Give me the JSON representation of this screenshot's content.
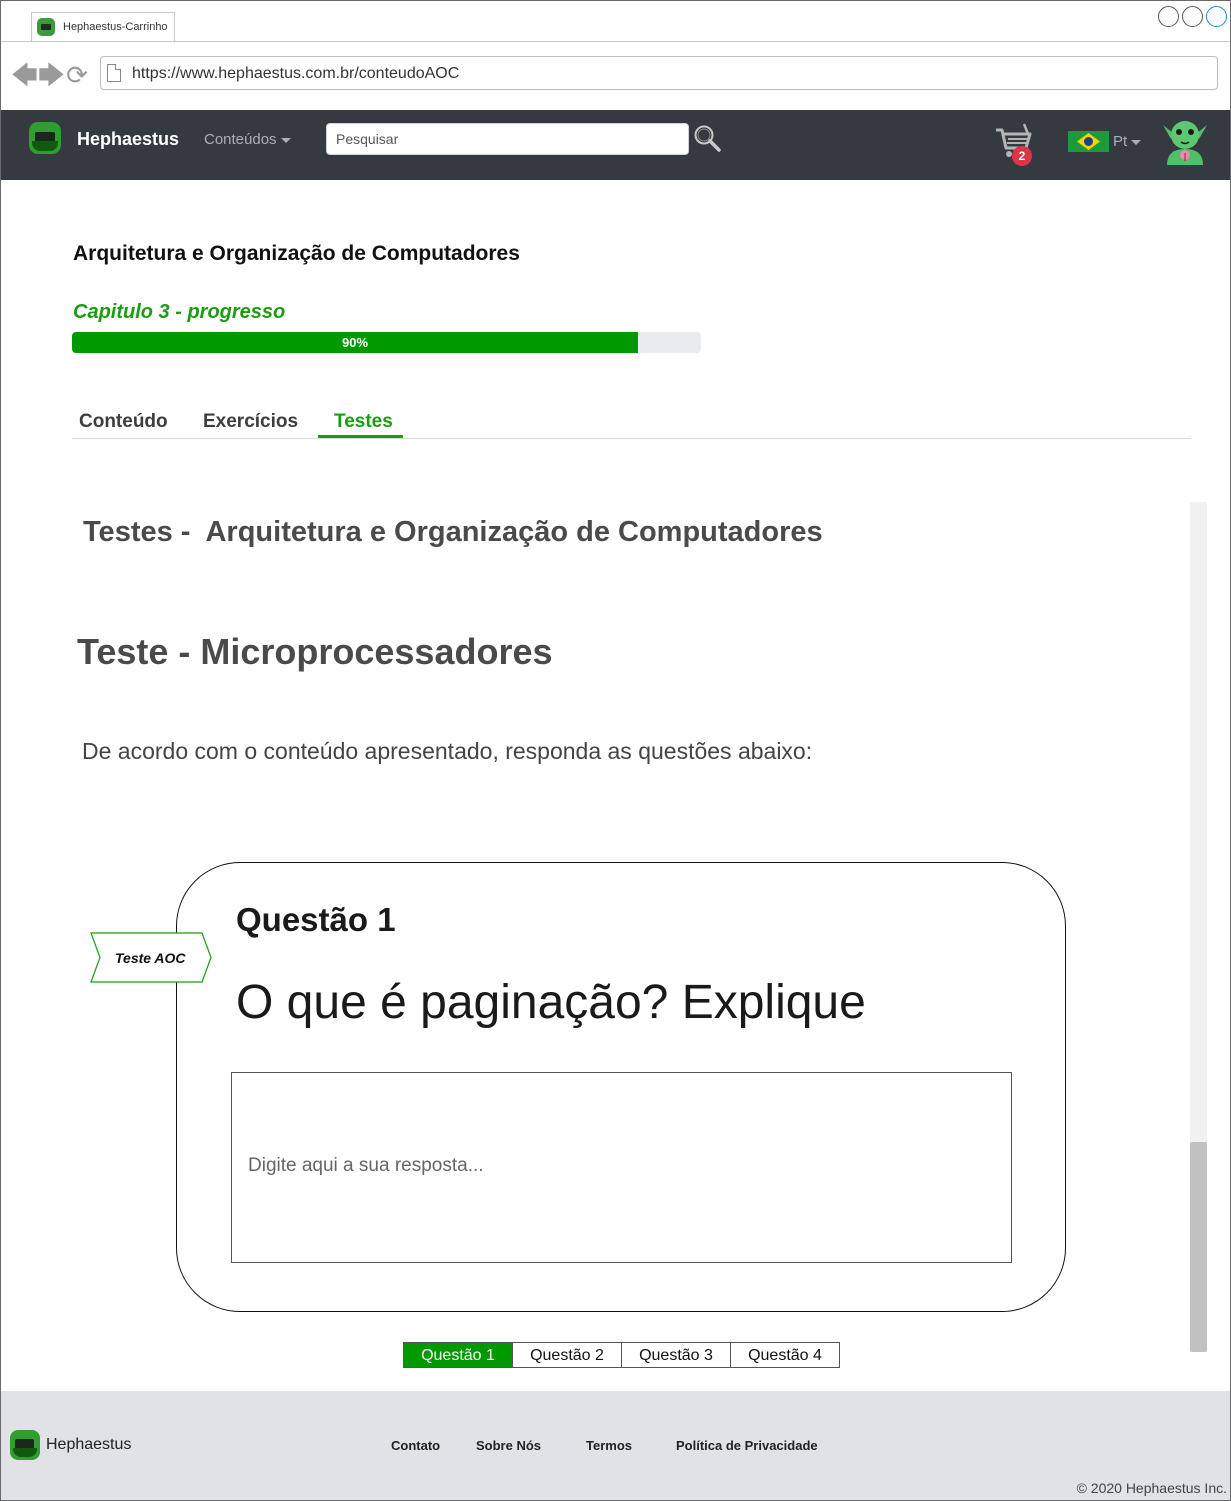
{
  "browser": {
    "tab_title": "Hephaestus-Carrinho",
    "url": "https://www.hephaestus.com.br/conteudoAOC"
  },
  "navbar": {
    "brand": "Hephaestus",
    "menu_label": "Conteúdos",
    "search_placeholder": "Pesquisar",
    "cart_count": "2",
    "language": "Pt"
  },
  "course": {
    "title": "Arquitetura e Organização de Computadores",
    "chapter_label": "Capitulo 3 - progresso",
    "progress_text": "90%",
    "progress_value": 90
  },
  "tabs": [
    {
      "label": "Conteúdo",
      "active": false
    },
    {
      "label": "Exercícios",
      "active": false
    },
    {
      "label": "Testes",
      "active": true
    }
  ],
  "tests": {
    "section_title": "Testes -  Arquitetura e Organização de Computadores",
    "test_title": "Teste - Microprocessadores",
    "instructions": "De acordo com o conteúdo apresentado, responda as questões abaixo:"
  },
  "question": {
    "ribbon_label": "Teste AOC",
    "number_label": "Questão 1",
    "text": "O que é paginação? Explique",
    "answer_placeholder": "Digite aqui a sua resposta..."
  },
  "pagination": [
    "Questão 1",
    "Questão 2",
    "Questão 3",
    "Questão 4"
  ],
  "pagination_active": 0,
  "footer": {
    "brand": "Hephaestus",
    "links": [
      "Contato",
      "Sobre Nós",
      "Termos",
      "Política de Privacidade"
    ],
    "copyright": "© 2020 Hephaestus Inc."
  },
  "colors": {
    "accent_green": "#1b9c12",
    "progress_green": "#009a00",
    "navbar_bg": "#343a40",
    "badge_red": "#dc3545",
    "footer_bg": "#e1e2e6"
  },
  "icons": [
    "back-arrow-icon",
    "forward-arrow-icon",
    "reload-icon",
    "page-icon",
    "logo-icon",
    "search-icon",
    "cart-icon",
    "brazil-flag-icon",
    "user-avatar-icon"
  ]
}
